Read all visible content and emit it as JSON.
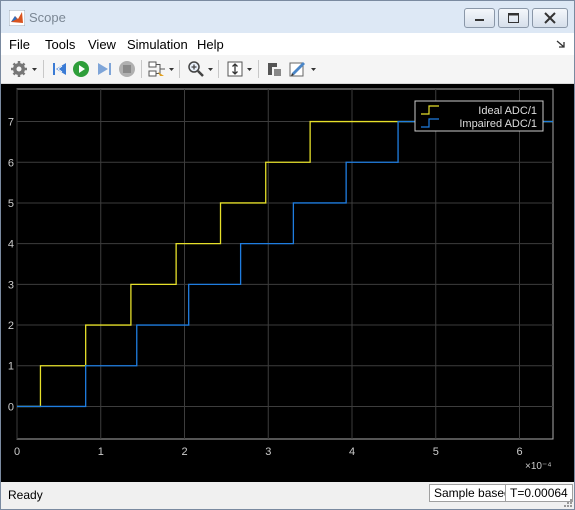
{
  "window": {
    "title": "Scope"
  },
  "menu": {
    "items": [
      "File",
      "Tools",
      "View",
      "Simulation",
      "Help"
    ]
  },
  "toolbar": {
    "icons": [
      "gear-icon",
      "step-back-icon",
      "run-icon",
      "step-forward-icon",
      "stop-icon",
      "highlight-block-icon",
      "zoom-icon",
      "autoscale-icon",
      "restore-layout-icon",
      "style-icon"
    ]
  },
  "status": {
    "left": "Ready",
    "mode": "Sample based",
    "time": "T=0.00064"
  },
  "chart_data": {
    "type": "line",
    "step": true,
    "xlim": [
      0,
      6.4
    ],
    "ylim": [
      -0.8,
      7.8
    ],
    "x_scale_label": "×10⁻⁴",
    "xticks": [
      "0",
      "1",
      "2",
      "3",
      "4",
      "5",
      "6"
    ],
    "yticks": [
      "0",
      "1",
      "2",
      "3",
      "4",
      "5",
      "6",
      "7"
    ],
    "grid": true,
    "legend_position": "top-right",
    "series": [
      {
        "name": "Ideal ADC/1",
        "color": "#e6e02a",
        "x": [
          0,
          0.28,
          0.82,
          1.36,
          1.9,
          2.43,
          2.97,
          3.5,
          6.4
        ],
        "y": [
          0,
          1,
          2,
          3,
          4,
          5,
          6,
          7,
          7
        ]
      },
      {
        "name": "Impaired ADC/1",
        "color": "#1f7de0",
        "x": [
          0,
          0.82,
          1.43,
          2.05,
          2.67,
          3.3,
          3.93,
          4.55,
          6.4
        ],
        "y": [
          0,
          1,
          2,
          3,
          4,
          5,
          6,
          7,
          7
        ]
      }
    ]
  }
}
